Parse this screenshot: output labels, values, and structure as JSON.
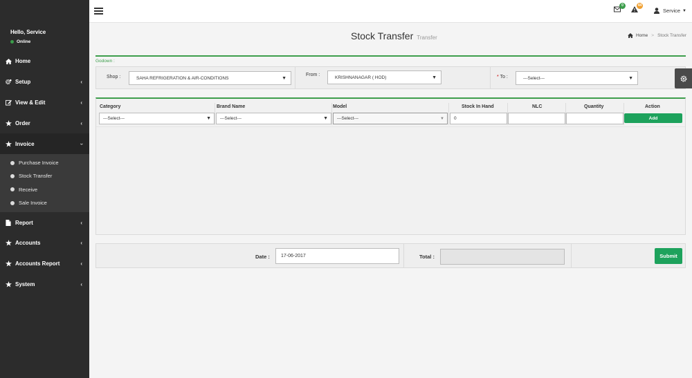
{
  "user": {
    "greeting": "Hello, Service",
    "status": "Online"
  },
  "sidebar": {
    "items": [
      {
        "label": "Home",
        "icon": "home-icon"
      },
      {
        "label": "Setup",
        "icon": "gears-icon"
      },
      {
        "label": "View & Edit",
        "icon": "edit-icon"
      },
      {
        "label": "Order",
        "icon": "star-icon"
      },
      {
        "label": "Invoice",
        "icon": "star-icon"
      },
      {
        "label": "Report",
        "icon": "file-icon"
      },
      {
        "label": "Accounts",
        "icon": "star-icon"
      },
      {
        "label": "Accounts Report",
        "icon": "star-icon"
      },
      {
        "label": "System",
        "icon": "star-icon"
      }
    ],
    "invoice_sub": [
      "Purchase Invoice",
      "Stock Transfer",
      "Receive",
      "Sale Invoice"
    ]
  },
  "topbar": {
    "mail_count": "0",
    "alert_count": "44",
    "user_label": "Service",
    "colors": {
      "mail_badge": "#3c9d4b",
      "alert_badge": "#f0a030"
    }
  },
  "page": {
    "title": "Stock Transfer",
    "subtitle": "Transfer"
  },
  "breadcrumb": {
    "home": "Home",
    "current": "Stock Transfer"
  },
  "godown": {
    "label": "Godown :",
    "shop_label": "Shop :",
    "shop_value": "SAHA REFRIGERATION & AIR-CONDITIONS",
    "from_label": "From :",
    "from_value": "KRISHNANAGAR ( HOD)",
    "to_required": "*",
    "to_label": "To :",
    "to_value": "---Select---"
  },
  "table": {
    "headers": {
      "category": "Category",
      "brand": "Brand Name",
      "model": "Model",
      "stock": "Stock In Hand",
      "nlc": "NLC",
      "quantity": "Quantity",
      "action": "Action"
    },
    "row": {
      "category": "---Select---",
      "brand": "---Select---",
      "model": "---Select---",
      "stock": "0",
      "nlc": "",
      "quantity": ""
    },
    "add_label": "Add"
  },
  "footer": {
    "date_label": "Date :",
    "date_value": "17-06-2017",
    "total_label": "Total :",
    "total_value": "",
    "submit_label": "Submit"
  },
  "colors": {
    "accent": "#3c9d4b",
    "button": "#1da25c",
    "sidebar": "#2c2c2c"
  }
}
